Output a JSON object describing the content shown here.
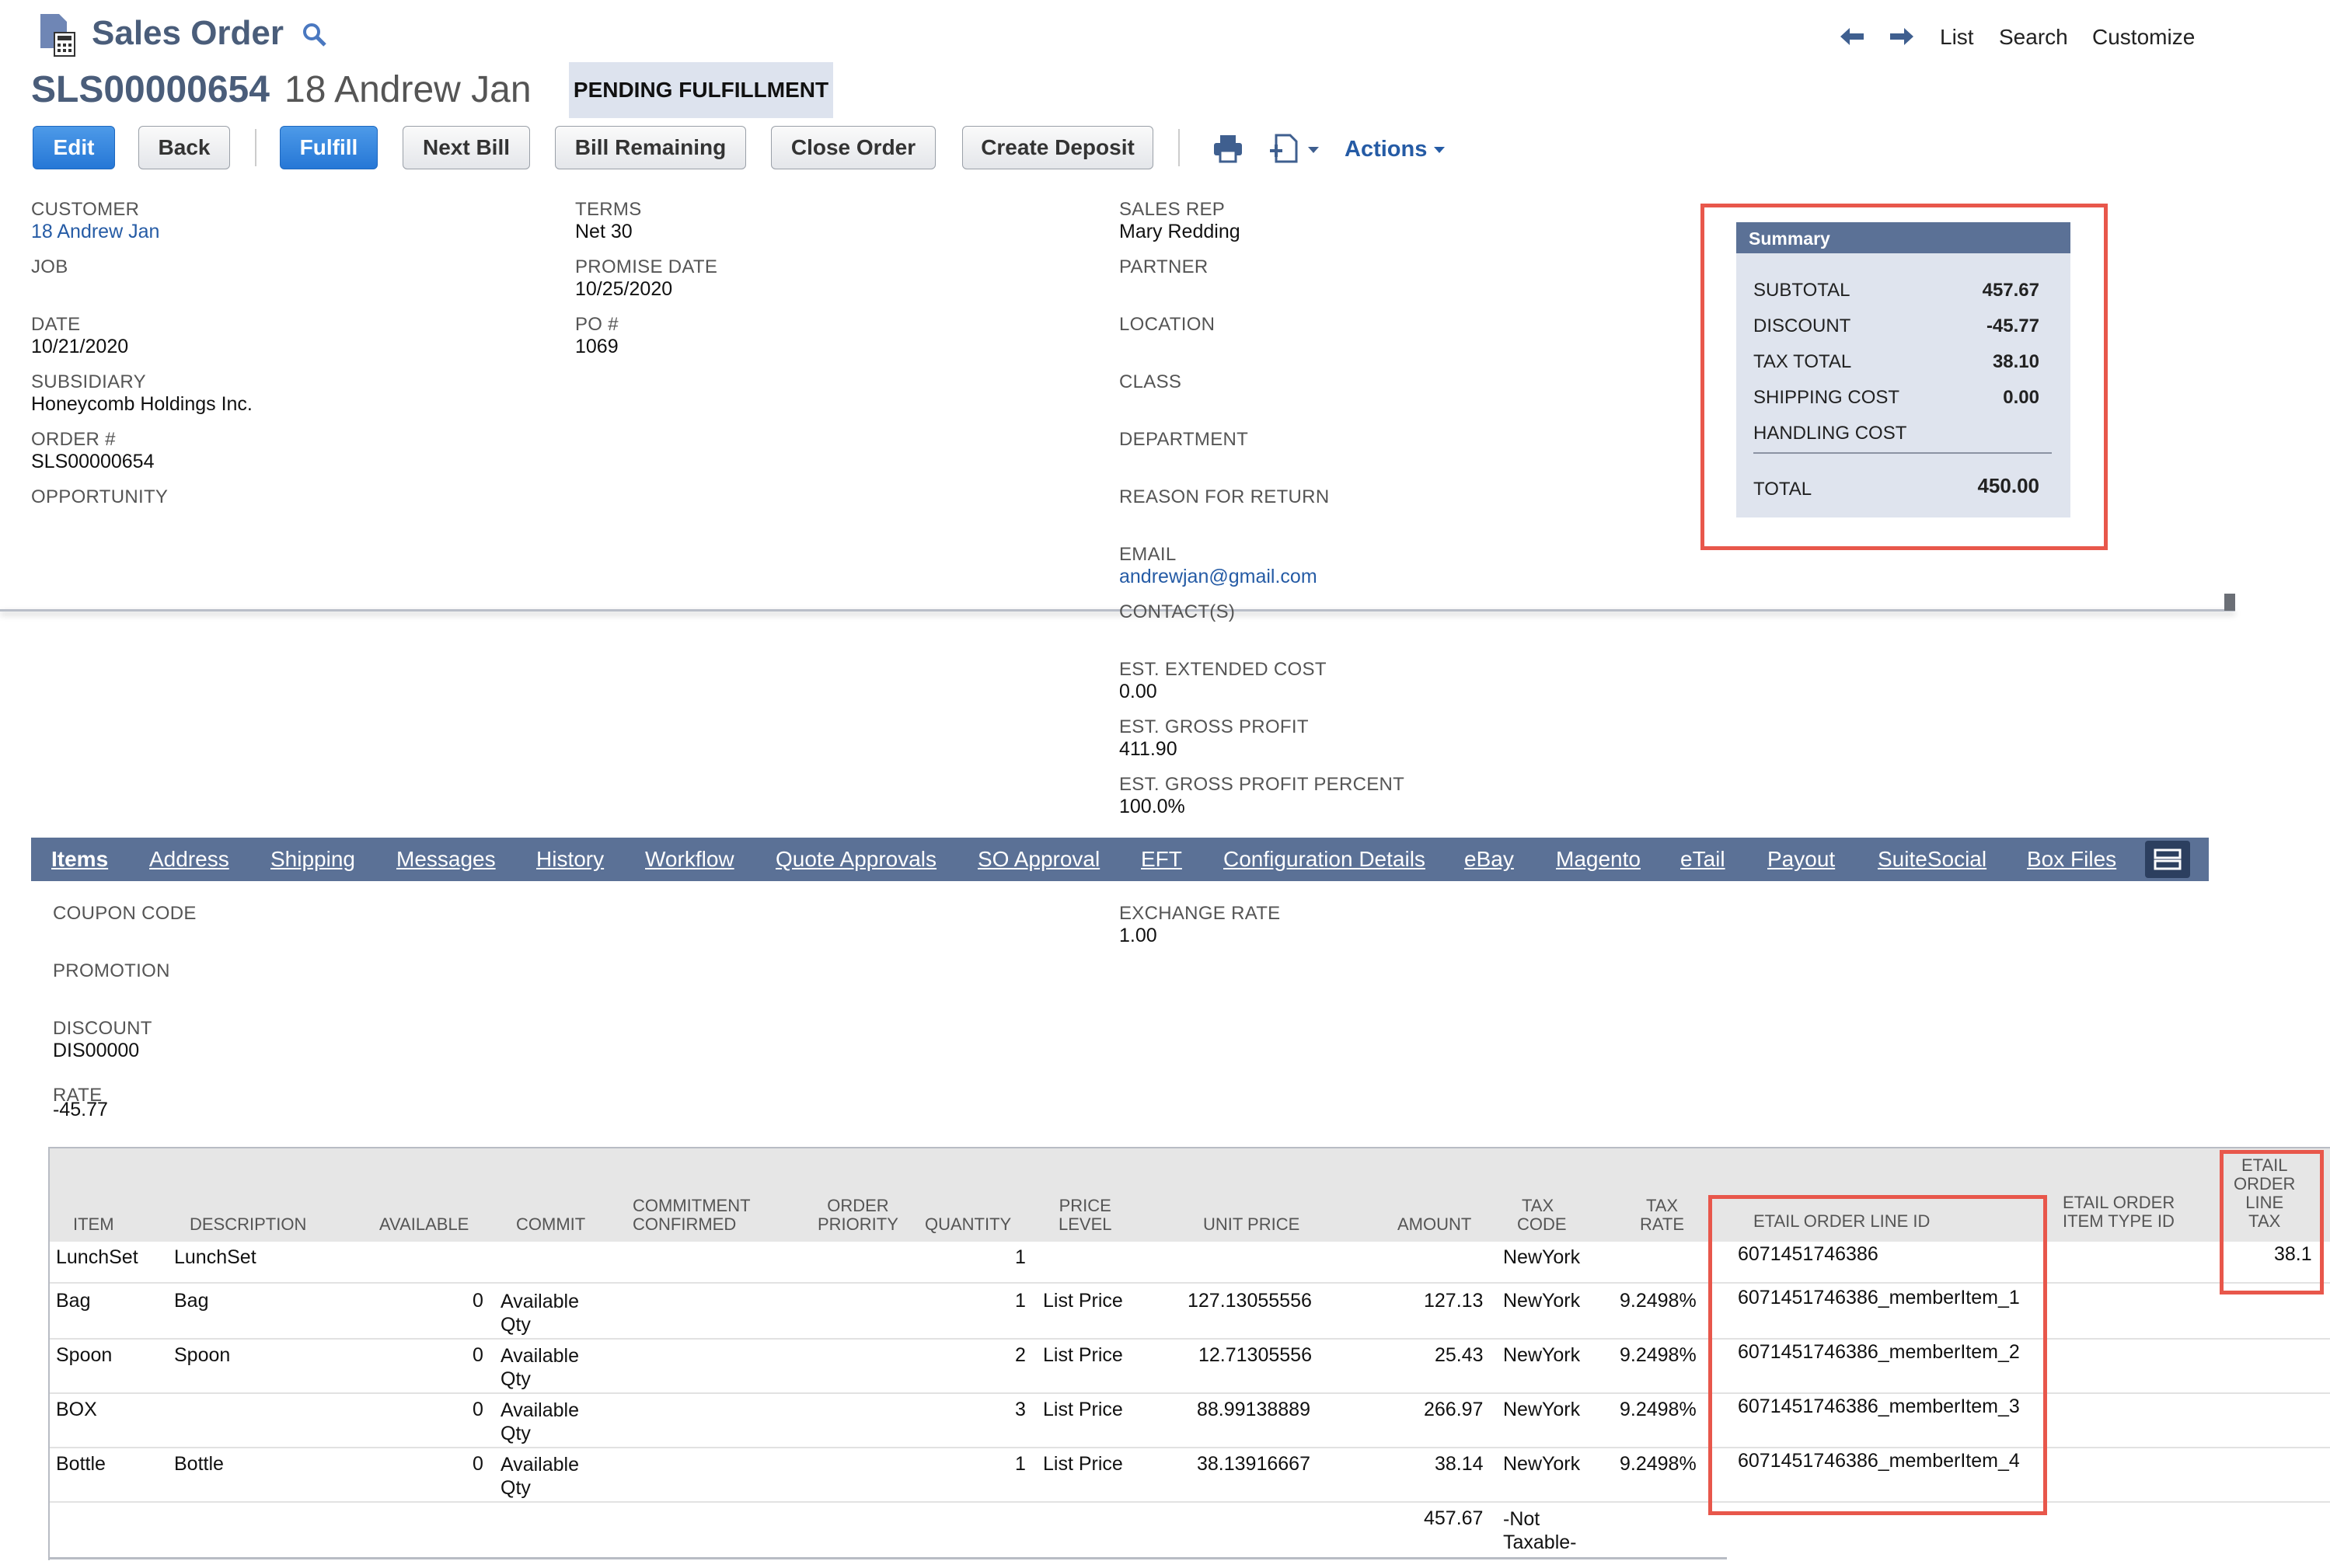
{
  "header": {
    "title": "Sales Order",
    "record_id": "SLS00000654",
    "record_name": "18 Andrew Jan",
    "status": "PENDING FULFILLMENT",
    "nav": {
      "list": "List",
      "search": "Search",
      "customize": "Customize"
    }
  },
  "toolbar": {
    "edit": "Edit",
    "back": "Back",
    "fulfill": "Fulfill",
    "next_bill": "Next Bill",
    "bill_remaining": "Bill Remaining",
    "close_order": "Close Order",
    "create_deposit": "Create Deposit",
    "actions": "Actions"
  },
  "fields": {
    "customer_label": "CUSTOMER",
    "customer": "18 Andrew Jan",
    "job_label": "JOB",
    "date_label": "DATE",
    "date": "10/21/2020",
    "subsidiary_label": "SUBSIDIARY",
    "subsidiary": "Honeycomb Holdings Inc.",
    "order_label": "ORDER #",
    "order": "SLS00000654",
    "opportunity_label": "OPPORTUNITY",
    "terms_label": "TERMS",
    "terms": "Net 30",
    "promise_label": "PROMISE DATE",
    "promise": "10/25/2020",
    "po_label": "PO #",
    "po": "1069",
    "salesrep_label": "SALES REP",
    "salesrep": "Mary Redding",
    "partner_label": "PARTNER",
    "location_label": "LOCATION",
    "class_label": "CLASS",
    "department_label": "DEPARTMENT",
    "reason_label": "REASON FOR RETURN",
    "email_label": "EMAIL",
    "email": "andrewjan@gmail.com",
    "contacts_label": "CONTACT(S)",
    "extcost_label": "EST. EXTENDED COST",
    "extcost": "0.00",
    "grossprofit_label": "EST. GROSS PROFIT",
    "grossprofit": "411.90",
    "gpp_label": "EST. GROSS PROFIT PERCENT",
    "gpp": "100.0%"
  },
  "summary": {
    "title": "Summary",
    "subtotal_label": "SUBTOTAL",
    "subtotal": "457.67",
    "discount_label": "DISCOUNT",
    "discount": "-45.77",
    "taxtotal_label": "TAX TOTAL",
    "taxtotal": "38.10",
    "shipping_label": "SHIPPING COST",
    "shipping": "0.00",
    "handling_label": "HANDLING COST",
    "total_label": "TOTAL",
    "total": "450.00"
  },
  "tabs": [
    "Items",
    "Address",
    "Shipping",
    "Messages",
    "History",
    "Workflow",
    "Quote Approvals",
    "SO Approval",
    "EFT",
    "Configuration Details",
    "eBay",
    "Magento",
    "eTail",
    "Payout",
    "SuiteSocial",
    "Box Files"
  ],
  "items_section": {
    "coupon_label": "COUPON CODE",
    "promotion_label": "PROMOTION",
    "discount_label": "DISCOUNT",
    "discount": "DIS00000",
    "rate_label": "RATE",
    "rate": "-45.77",
    "exchange_label": "EXCHANGE RATE",
    "exchange": "1.00"
  },
  "table": {
    "headers": {
      "item": "ITEM",
      "description": "DESCRIPTION",
      "available": "AVAILABLE",
      "commit": "COMMIT",
      "commitment_1": "COMMITMENT",
      "commitment_2": "CONFIRMED",
      "priority_1": "ORDER",
      "priority_2": "PRIORITY",
      "quantity": "QUANTITY",
      "price_level_1": "PRICE",
      "price_level_2": "LEVEL",
      "unit_price": "UNIT PRICE",
      "amount": "AMOUNT",
      "tax_code_1": "TAX",
      "tax_code_2": "CODE",
      "tax_rate_1": "TAX",
      "tax_rate_2": "RATE",
      "etail_line_id": "ETAIL ORDER LINE ID",
      "etail_type_1": "ETAIL ORDER",
      "etail_type_2": "ITEM TYPE ID",
      "etail_tax_1": "ETAIL",
      "etail_tax_2": "ORDER",
      "etail_tax_3": "LINE",
      "etail_tax_4": "TAX"
    },
    "rows": [
      {
        "item": "LunchSet",
        "description": "LunchSet",
        "available": "",
        "commit_1": "",
        "commit_2": "",
        "quantity": "1",
        "price_level": "",
        "unit_price": "",
        "amount": "",
        "tax_code": "NewYork",
        "tax_rate": "",
        "line_id": "6071451746386",
        "line_tax": "38.1"
      },
      {
        "item": "Bag",
        "description": "Bag",
        "available": "0",
        "commit_1": "Available",
        "commit_2": "Qty",
        "quantity": "1",
        "price_level": "List Price",
        "unit_price": "127.13055556",
        "amount": "127.13",
        "tax_code": "NewYork",
        "tax_rate": "9.2498%",
        "line_id": "6071451746386_memberItem_1",
        "line_tax": ""
      },
      {
        "item": "Spoon",
        "description": "Spoon",
        "available": "0",
        "commit_1": "Available",
        "commit_2": "Qty",
        "quantity": "2",
        "price_level": "List Price",
        "unit_price": "12.71305556",
        "amount": "25.43",
        "tax_code": "NewYork",
        "tax_rate": "9.2498%",
        "line_id": "6071451746386_memberItem_2",
        "line_tax": ""
      },
      {
        "item": "BOX",
        "description": "",
        "available": "0",
        "commit_1": "Available",
        "commit_2": "Qty",
        "quantity": "3",
        "price_level": "List Price",
        "unit_price": "88.99138889",
        "amount": "266.97",
        "tax_code": "NewYork",
        "tax_rate": "9.2498%",
        "line_id": "6071451746386_memberItem_3",
        "line_tax": ""
      },
      {
        "item": "Bottle",
        "description": "Bottle",
        "available": "0",
        "commit_1": "Available",
        "commit_2": "Qty",
        "quantity": "1",
        "price_level": "List Price",
        "unit_price": "38.13916667",
        "amount": "38.14",
        "tax_code": "NewYork",
        "tax_rate": "9.2498%",
        "line_id": "6071451746386_memberItem_4",
        "line_tax": ""
      },
      {
        "item": "",
        "description": "",
        "available": "",
        "commit_1": "",
        "commit_2": "",
        "quantity": "",
        "price_level": "",
        "unit_price": "",
        "amount": "457.67",
        "tax_code": "-Not",
        "tax_code_2": "Taxable-",
        "tax_rate": "",
        "line_id": "",
        "line_tax": ""
      }
    ]
  },
  "colors": {
    "accent_blue": "#2677d6",
    "tab_bar": "#5b7196",
    "highlight_red": "#e8574b",
    "summary_bg": "#dfe4ee"
  },
  "icons": [
    "document-calculator-icon",
    "search-icon",
    "arrow-left-icon",
    "arrow-right-icon",
    "print-icon",
    "add-document-icon",
    "chevron-down-icon",
    "list-toggle-icon"
  ]
}
